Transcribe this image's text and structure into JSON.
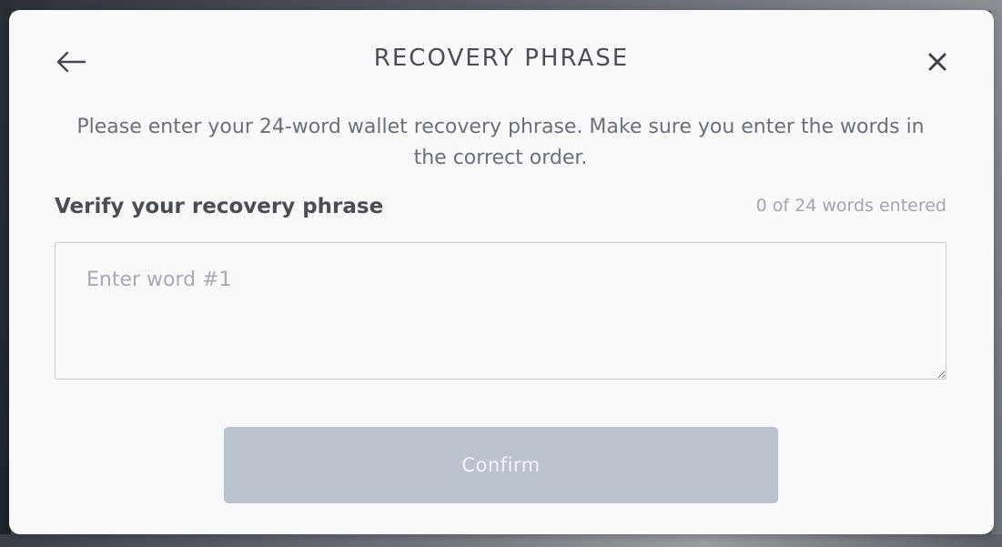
{
  "modal": {
    "title": "RECOVERY PHRASE",
    "back_icon": "arrow-left-icon",
    "close_icon": "close-icon",
    "description": "Please enter your 24-word wallet recovery phrase. Make sure you enter the words in the correct order."
  },
  "verify": {
    "label": "Verify your recovery phrase",
    "counter": "0 of 24 words entered",
    "input_placeholder": "Enter word #1",
    "input_value": ""
  },
  "actions": {
    "confirm_label": "Confirm",
    "confirm_disabled": true
  },
  "colors": {
    "modal_bg": "#f8f9fb",
    "title": "#4b4f55",
    "description": "#6b7078",
    "counter": "#a2a6ad",
    "confirm_disabled_bg": "#bcc3ce"
  }
}
